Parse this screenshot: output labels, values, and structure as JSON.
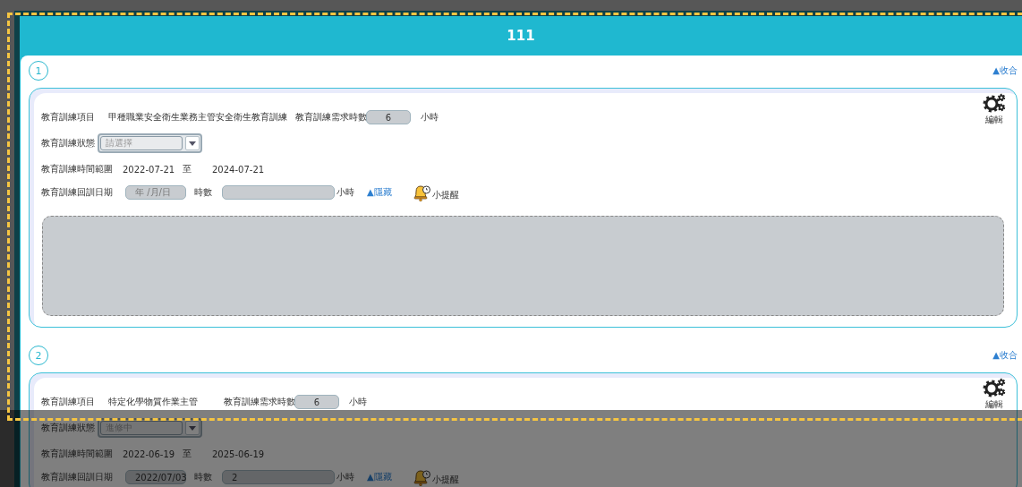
{
  "header": {
    "title": "111"
  },
  "sections": [
    {
      "number": "1",
      "collapse": "▲收合",
      "edit": "編輯",
      "item_label": "教育訓練項目",
      "item_value": "甲種職業安全衛生業務主管安全衛生教育訓練",
      "required_hours_label": "教育訓練需求時數",
      "required_hours": "6",
      "required_hours_unit": "小時",
      "status_label": "教育訓練狀態",
      "status": {
        "placeholder": "請選擇"
      },
      "range_label": "教育訓練時間範圍",
      "range_start": "2022-07-21",
      "range_sep": "至",
      "range_end": "2024-07-21",
      "retrain_label": "教育訓練回訓日期",
      "retrain_date": {
        "placeholder": "年 /月/日"
      },
      "retrain_hours_label": "時數",
      "retrain_hours_unit": "小時",
      "hide": "▲隱藏",
      "reminder": "小提醒",
      "notes_area": true
    },
    {
      "number": "2",
      "collapse": "▲收合",
      "edit": "編輯",
      "item_label": "教育訓練項目",
      "item_value": "特定化學物質作業主管",
      "required_hours_label": "教育訓練需求時數",
      "required_hours": "6",
      "required_hours_unit": "小時",
      "status_label": "教育訓練狀態",
      "status": {
        "value": "進修中"
      },
      "range_label": "教育訓練時間範圍",
      "range_start": "2022-06-19",
      "range_sep": "至",
      "range_end": "2025-06-19",
      "retrain_label": "教育訓練回訓日期",
      "retrain_date": {
        "value": "2022/07/03"
      },
      "retrain_hours_label": "時數",
      "retrain_hours": {
        "value": "2"
      },
      "retrain_hours_unit": "小時",
      "hide": "▲隱藏",
      "reminder": "小提醒",
      "notes_area": false
    }
  ]
}
